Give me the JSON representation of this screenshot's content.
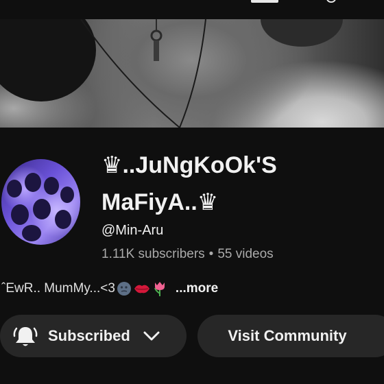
{
  "channel": {
    "title_line1": "♛..JuNgKoOk'S",
    "title_line2": "MaFiyA..♛",
    "handle": "@Min-Aru",
    "subscribers": "1.11K subscribers",
    "separator": "•",
    "videos": "55 videos"
  },
  "description": {
    "text": "ˆEwR.. MumMy...<3",
    "more_label": "...more",
    "emojis": [
      "new-moon-face",
      "lips-kiss",
      "tulip"
    ]
  },
  "actions": {
    "subscribed_label": "Subscribed",
    "community_label": "Visit Community"
  },
  "colors": {
    "background": "#0f0f0f",
    "button_bg": "#272727",
    "secondary_text": "#aaaaaa",
    "avatar_accent": "#6a52d8"
  }
}
